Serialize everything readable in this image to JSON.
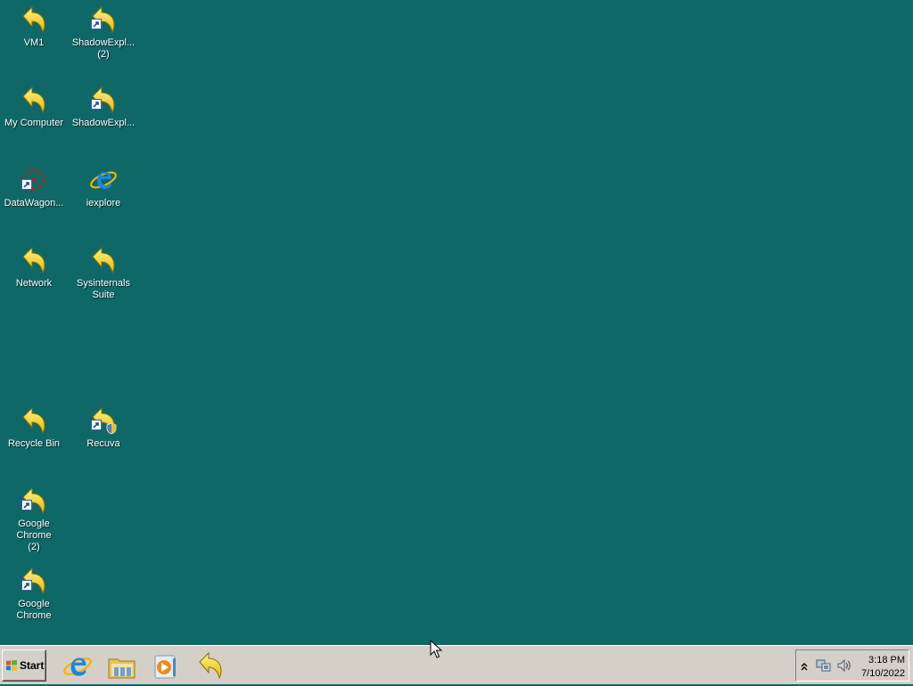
{
  "desktop": {
    "background_color": "#0e6868",
    "icons": [
      {
        "label": "VM1",
        "icon": "shortcut-arrow-icon"
      },
      {
        "label": "ShadowExpl...\n(2)",
        "icon": "shortcut-arrow-icon"
      },
      {
        "label": "My Computer",
        "icon": "shortcut-arrow-icon"
      },
      {
        "label": "ShadowExpl...",
        "icon": "shortcut-arrow-icon"
      },
      {
        "label": "DataWagon...",
        "icon": "datawagon-icon"
      },
      {
        "label": "iexplore",
        "icon": "internet-explorer-icon"
      },
      {
        "label": "Network",
        "icon": "shortcut-arrow-icon"
      },
      {
        "label": "Sysinternals\nSuite",
        "icon": "shortcut-arrow-icon"
      },
      {
        "label": "Recycle Bin",
        "icon": "shortcut-arrow-icon"
      },
      {
        "label": "Recuva",
        "icon": "shortcut-arrow-icon"
      },
      {
        "label": "Google Chrome\n(2)",
        "icon": "shortcut-arrow-icon"
      },
      {
        "label": "Google Chrome",
        "icon": "shortcut-arrow-icon"
      }
    ]
  },
  "taskbar": {
    "start_label": "Start",
    "pinned": [
      "internet-explorer-icon",
      "windows-explorer-icon",
      "media-player-icon",
      "shortcut-arrow-icon"
    ],
    "tray": {
      "icons": [
        "show-hidden-icons-chevron",
        "network-icon",
        "volume-icon"
      ],
      "time": "3:18 PM",
      "date": "7/10/2022"
    }
  }
}
